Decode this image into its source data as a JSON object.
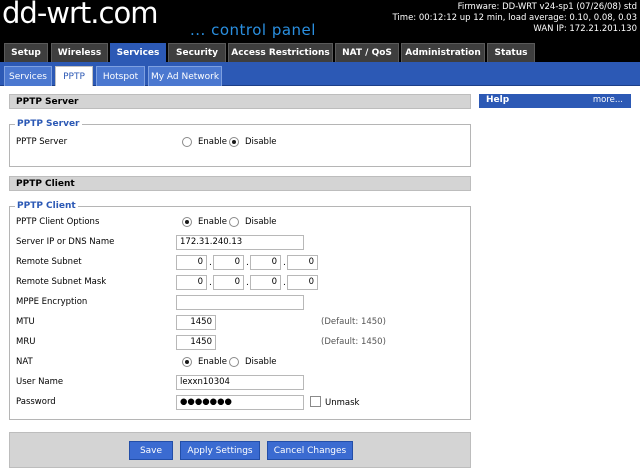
{
  "header": {
    "brand_main": "dd-wrt",
    "brand_dot": ".",
    "brand_tld": "com",
    "tagline": "... control panel",
    "firmware": "Firmware: DD-WRT v24-sp1 (07/26/08) std",
    "time": "Time: 00:12:12 up 12 min, load average: 0.10, 0.08, 0.03",
    "wan_ip": "WAN IP: 172.21.201.130"
  },
  "main_tabs": [
    {
      "label": "Setup"
    },
    {
      "label": "Wireless"
    },
    {
      "label": "Services"
    },
    {
      "label": "Security"
    },
    {
      "label": "Access Restrictions"
    },
    {
      "label": "NAT / QoS"
    },
    {
      "label": "Administration"
    },
    {
      "label": "Status"
    }
  ],
  "sub_tabs": [
    {
      "label": "Services"
    },
    {
      "label": "PPTP"
    },
    {
      "label": "Hotspot"
    },
    {
      "label": "My Ad Network"
    }
  ],
  "server": {
    "section_title": "PPTP Server",
    "legend": "PPTP Server",
    "label": "PPTP Server",
    "enable": "Enable",
    "disable": "Disable",
    "selected": "disable"
  },
  "client": {
    "section_title": "PPTP Client",
    "legend": "PPTP Client",
    "options_label": "PPTP Client Options",
    "options_enable": "Enable",
    "options_disable": "Disable",
    "options_selected": "enable",
    "server_label": "Server IP or DNS Name",
    "server_value": "172.31.240.13",
    "subnet_label": "Remote Subnet",
    "subnet": [
      "0",
      "0",
      "0",
      "0"
    ],
    "mask_label": "Remote Subnet Mask",
    "mask": [
      "0",
      "0",
      "0",
      "0"
    ],
    "dot": ".",
    "mppe_label": "MPPE Encryption",
    "mppe_value": "",
    "mtu_label": "MTU",
    "mtu_value": "1450",
    "mtu_default": "(Default: 1450)",
    "mru_label": "MRU",
    "mru_value": "1450",
    "mru_default": "(Default: 1450)",
    "nat_label": "NAT",
    "nat_enable": "Enable",
    "nat_disable": "Disable",
    "nat_selected": "enable",
    "user_label": "User Name",
    "user_value": "lexxn10304",
    "pass_label": "Password",
    "pass_value": "●●●●●●●",
    "unmask_label": "Unmask"
  },
  "buttons": {
    "save": "Save",
    "apply": "Apply Settings",
    "cancel": "Cancel Changes"
  },
  "help": {
    "title": "Help",
    "more": "more..."
  }
}
